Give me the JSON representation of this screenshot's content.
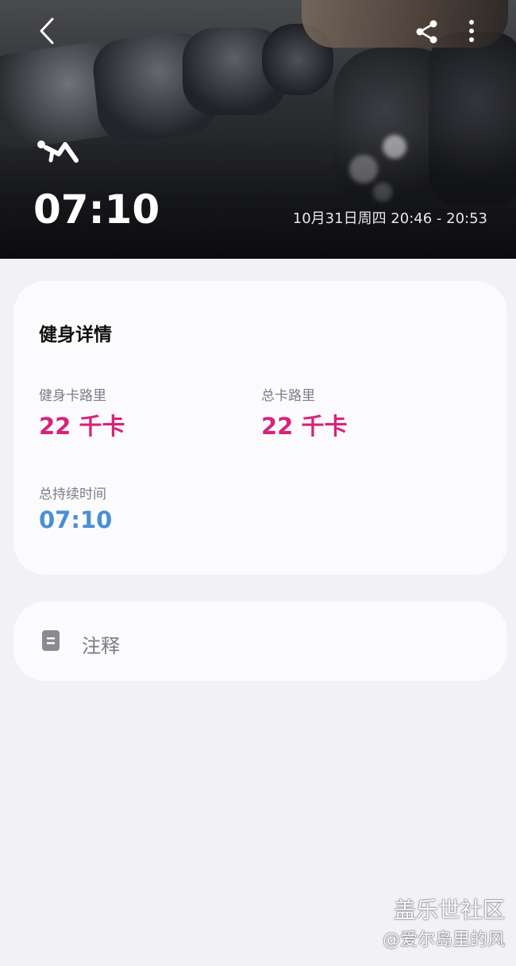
{
  "header": {
    "duration": "07:10",
    "datetime": "10月31日周四 20:46 - 20:53"
  },
  "details": {
    "title": "健身详情",
    "workout_calories_label": "健身卡路里",
    "workout_calories_value": "22 千卡",
    "total_calories_label": "总卡路里",
    "total_calories_value": "22 千卡",
    "total_duration_label": "总持续时间",
    "total_duration_value": "07:10"
  },
  "notes": {
    "label": "注释"
  },
  "watermark": {
    "line1": "盖乐世社区",
    "line2": "@爱尔岛里的风"
  },
  "colors": {
    "accent_pink": "#d6247a",
    "accent_blue": "#4a8fd4",
    "background": "#f2f1f6",
    "card": "#fbfbfd"
  },
  "icons": [
    "back-icon",
    "share-icon",
    "more-options-icon",
    "workout-type-icon",
    "note-icon"
  ]
}
